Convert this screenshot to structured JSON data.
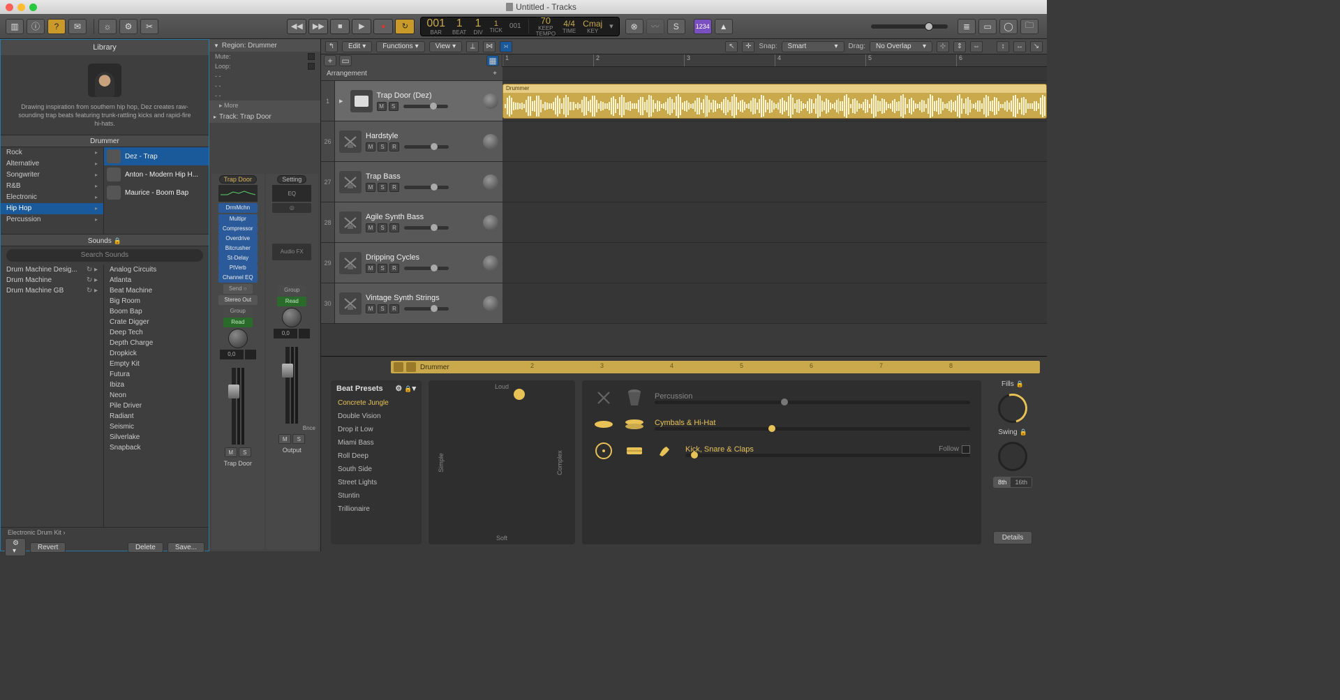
{
  "window": {
    "title": "Untitled - Tracks"
  },
  "lcd": {
    "bar": "001",
    "beat": "1",
    "div": "1",
    "tick": "1",
    "pos": "001",
    "tempo": "70",
    "tempo_sub": "KEEP\nTEMPO",
    "sig": "4/4",
    "sig_sub": "TIME",
    "key": "Cmaj",
    "key_sub": "KEY",
    "labels": {
      "bar": "BAR",
      "beat": "BEAT",
      "div": "DIV",
      "tick": "TICK"
    }
  },
  "display_mode": "1234",
  "library": {
    "title": "Library",
    "description": "Drawing inspiration from southern hip hop, Dez creates raw-sounding trap beats featuring trunk-rattling kicks and rapid-fire hi-hats.",
    "drummers_header": "Drummer",
    "genres": [
      "Rock",
      "Alternative",
      "Songwriter",
      "R&B",
      "Electronic",
      "Hip Hop",
      "Percussion"
    ],
    "genre_selected": "Hip Hop",
    "drummers": [
      {
        "name": "Dez - Trap",
        "sel": true
      },
      {
        "name": "Anton - Modern Hip H..."
      },
      {
        "name": "Maurice - Boom Bap"
      }
    ],
    "sounds_header": "Sounds",
    "search_placeholder": "Search Sounds",
    "sound_cats": [
      {
        "name": "Drum Machine Desig...",
        "icons": true
      },
      {
        "name": "Drum Machine",
        "icons": true
      },
      {
        "name": "Drum Machine GB",
        "icons": true
      }
    ],
    "sound_patches": [
      "Analog Circuits",
      "Atlanta",
      "Beat Machine",
      "Big Room",
      "Boom Bap",
      "Crate Digger",
      "Deep Tech",
      "Depth Charge",
      "Dropkick",
      "Empty Kit",
      "Futura",
      "Ibiza",
      "Neon",
      "Pile Driver",
      "Radiant",
      "Seismic",
      "Silverlake",
      "Snapback"
    ],
    "path": "Electronic Drum Kit  ›",
    "revert": "Revert",
    "delete": "Delete",
    "save": "Save..."
  },
  "inspector": {
    "region_title": "Region: Drummer",
    "mute": "Mute:",
    "loop": "Loop:",
    "more": "More",
    "track_title": "Track:  Trap Door",
    "strip1": {
      "name": "Trap Door",
      "setting_label": "Trap Door",
      "input": "DrmMchn",
      "inserts": [
        "Multipr",
        "Compressor",
        "Overdrive",
        "Bitcrusher",
        "St-Delay",
        "PtVerb",
        "Channel EQ"
      ],
      "send": "Send",
      "out": "Stereo Out",
      "group": "Group",
      "auto": "Read",
      "pan": "0,0",
      "label": "Trap Door",
      "m": "M",
      "s": "S"
    },
    "strip2": {
      "name": "Output",
      "setting": "Setting",
      "eq": "EQ",
      "stereo": "◎",
      "audiofx": "Audio FX",
      "group": "Group",
      "auto": "Read",
      "pan": "0,0",
      "bnce": "Bnce",
      "m": "M",
      "s": "S"
    }
  },
  "tracks_toolbar": {
    "edit": "Edit",
    "functions": "Functions",
    "view": "View",
    "snap_label": "Snap:",
    "snap": "Smart",
    "drag_label": "Drag:",
    "drag": "No Overlap"
  },
  "arrangement": "Arrangement",
  "ruler_marks": [
    "1",
    "2",
    "3",
    "4",
    "5",
    "6"
  ],
  "tracks": [
    {
      "num": "1",
      "name": "Trap Door (Dez)",
      "btns": [
        "M",
        "S"
      ],
      "sel": true,
      "region": "Drummer",
      "icon": "dm"
    },
    {
      "num": "26",
      "name": "Hardstyle",
      "btns": [
        "M",
        "S",
        "R"
      ],
      "icon": "synth"
    },
    {
      "num": "27",
      "name": "Trap Bass",
      "btns": [
        "M",
        "S",
        "R"
      ],
      "icon": "synth"
    },
    {
      "num": "28",
      "name": "Agile Synth Bass",
      "btns": [
        "M",
        "S",
        "R"
      ],
      "icon": "synth"
    },
    {
      "num": "29",
      "name": "Dripping Cycles",
      "btns": [
        "M",
        "S",
        "R"
      ],
      "icon": "synth"
    },
    {
      "num": "30",
      "name": "Vintage Synth Strings",
      "btns": [
        "M",
        "S",
        "R"
      ],
      "icon": "synth"
    }
  ],
  "drummer_editor": {
    "header": "Drummer",
    "ticks": [
      "2",
      "3",
      "4",
      "5",
      "6",
      "7",
      "8"
    ],
    "presets_title": "Beat Presets",
    "presets": [
      "Concrete Jungle",
      "Double Vision",
      "Drop it Low",
      "Miami Bass",
      "Roll Deep",
      "South Side",
      "Street Lights",
      "Stuntin",
      "Trillionaire"
    ],
    "preset_selected": "Concrete Jungle",
    "xy": {
      "top": "Loud",
      "bottom": "Soft",
      "left": "Simple",
      "right": "Complex"
    },
    "kit": {
      "perc": "Percussion",
      "cym": "Cymbals & Hi-Hat",
      "kick": "Kick, Snare & Claps",
      "follow": "Follow"
    },
    "fills": "Fills",
    "swing": "Swing",
    "seg": [
      "8th",
      "16th"
    ],
    "details": "Details"
  }
}
